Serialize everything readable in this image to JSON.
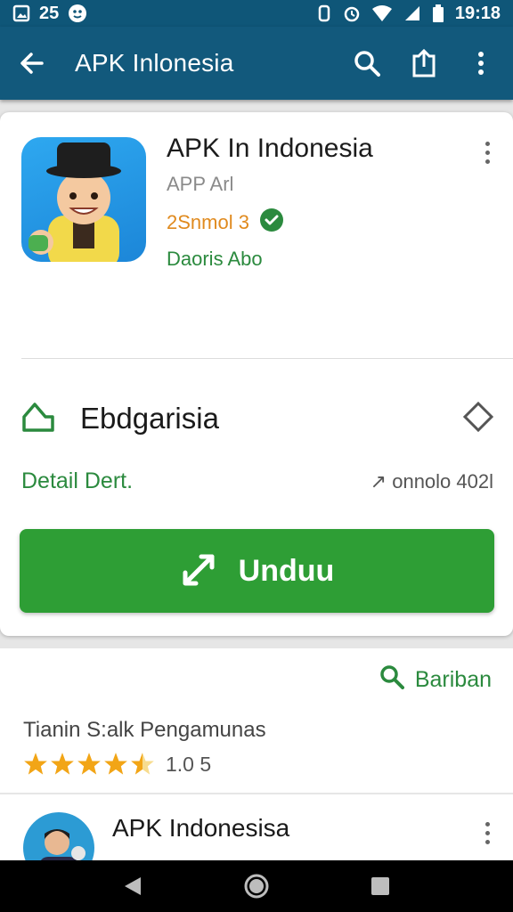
{
  "status_bar": {
    "left_text": "25",
    "time": "19:18"
  },
  "app_bar": {
    "title": "APK Inlonesia",
    "back_icon": "arrow-left-icon",
    "action_icons": [
      "search-icon",
      "share-icon",
      "more-vert-icon"
    ],
    "color": "#12597c"
  },
  "app_card": {
    "name": "APK In Indonesia",
    "subtitle": "APP Arl",
    "rating_text": "2Snmol 3",
    "developer": "Daoris Abo",
    "accent_orange": "#e08a1e",
    "accent_green": "#2b8a3e"
  },
  "section": {
    "label": "Ebdgarisia",
    "detail_left": "Detail Dert.",
    "detail_right": "↗ onnolo 402l"
  },
  "download_button": {
    "label": "Unduu",
    "color": "#2e9e35"
  },
  "reviews": {
    "search_link": "Bariban",
    "title": "Tianin S:alk Pengamunas",
    "stars_filled": 4.5,
    "stars_total": 5,
    "score": "1.0 5"
  },
  "list_item": {
    "title": "APK Indonesisa"
  },
  "nav_bar": {
    "buttons": [
      "back-triangle-icon",
      "home-circle-icon",
      "recents-square-icon"
    ]
  }
}
